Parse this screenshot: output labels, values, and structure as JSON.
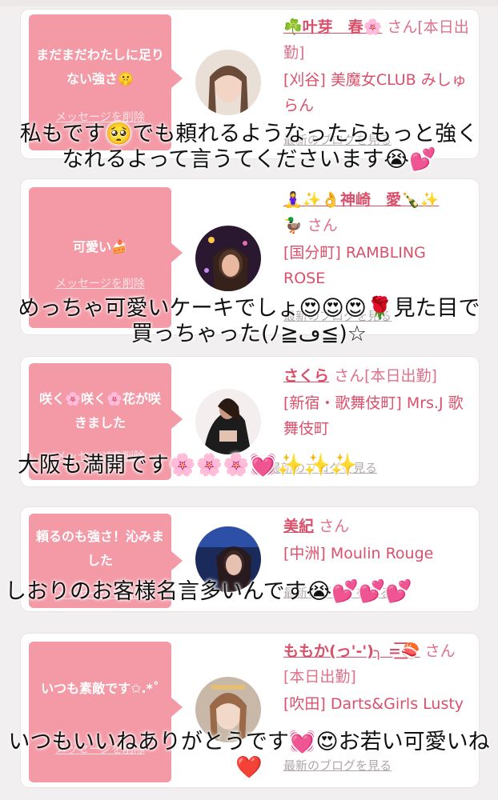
{
  "cards": [
    {
      "message": "まだまだわたしに足りない強さ🤫",
      "delete_label": "メッセージを削除",
      "cast_name": "☘️叶芽　春🌸",
      "suffix": "さん[本日出勤]",
      "shop": "[刈谷] 美魔女CLUB みしゅらん",
      "blog_label": "最新のブログを見る",
      "overlay": "私もです🥺でも頼れるようなったらもっと強くなれるよって言うてくださいます😭💕"
    },
    {
      "message": "可愛い🍰",
      "delete_label": "メッセージを削除",
      "cast_name": "🧘‍♀️✨👌神崎　愛🍾✨",
      "suffix": "🦆 さん",
      "shop": "[国分町] RAMBLING ROSE",
      "blog_label": "最新のブログを見る",
      "overlay": "めっちゃ可愛いケーキでしょ😍😍😍🌹見た目で買っちゃった(ﾉ≧ڡ≦)☆"
    },
    {
      "message": "咲く🌸咲く🌸花が咲きました",
      "delete_label": "メッセージを削除",
      "cast_name": "さくら",
      "suffix": "さん[本日出勤]",
      "shop": "[新宿・歌舞伎町] Mrs.J 歌舞伎町",
      "blog_label": "最新のブログを見る",
      "overlay": "大阪も満開です🌸🌸🌸💓✨✨✨"
    },
    {
      "message": "頼るのも強さ！沁みました",
      "delete_label": "メッセージを削除",
      "cast_name": "美紀",
      "suffix": "さん",
      "shop": "[中洲] Moulin Rouge",
      "blog_label": "最新のブログを見る",
      "overlay": "しおりのお客様名言多いんです😭💕💕💕"
    },
    {
      "message": "いつも素敵です✩.*˚",
      "delete_label": "メッセージを削除",
      "cast_name": "ももか(っ'-')╮ =͟͟͞͞🍣",
      "suffix": "さん[本日出勤]",
      "shop": "[吹田] Darts&Girls Lusty",
      "blog_label": "最新のブログを見る",
      "overlay": "いつもいいねありがとうです💓😍お若い可愛いね❤️"
    }
  ],
  "colors": {
    "accent_pink": "#f39aa6",
    "name_pink": "#d9506b",
    "background": "#f1efef"
  }
}
